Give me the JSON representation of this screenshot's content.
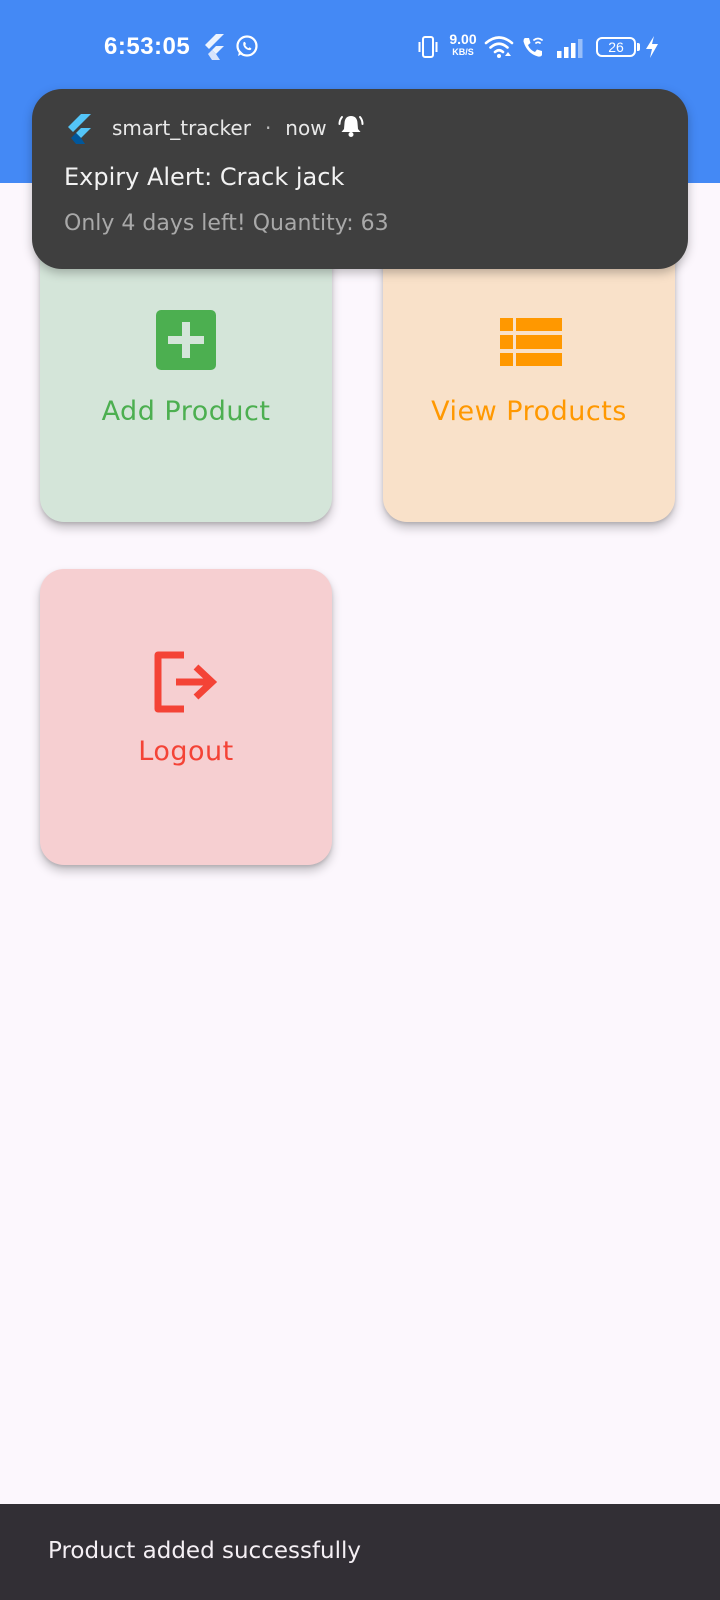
{
  "status_bar": {
    "time": "6:53:05",
    "network_speed_value": "9.00",
    "network_speed_unit": "KB/S",
    "battery_level": "26",
    "icons": [
      "flutter-icon",
      "whatsapp-icon",
      "vibrate-icon",
      "wifi-icon",
      "wifi-calling-icon",
      "signal-icon",
      "battery-icon",
      "charging-icon"
    ]
  },
  "notification": {
    "app_name": "smart_tracker",
    "separator": "·",
    "time": "now",
    "title": "Expiry Alert: Crack jack",
    "body": "Only 4 days left! Quantity: 63",
    "icons": [
      "flutter-icon",
      "alarm-bell-icon"
    ]
  },
  "dashboard": {
    "tiles": [
      {
        "label": "Add Product",
        "icon": "add-box-icon",
        "color": "#4caf50",
        "background": "#d4e5d9"
      },
      {
        "label": "View Products",
        "icon": "view-list-icon",
        "color": "#ff9800",
        "background": "#f9e1c9"
      },
      {
        "label": "Logout",
        "icon": "logout-icon",
        "color": "#f44336",
        "background": "#f6cfd1"
      }
    ]
  },
  "snackbar": {
    "message": "Product added successfully"
  },
  "colors": {
    "app_bar": "#4489f5",
    "page_background": "#fcf7fd",
    "notification_background": "#3f3f3f",
    "snackbar_background": "#322f35"
  }
}
